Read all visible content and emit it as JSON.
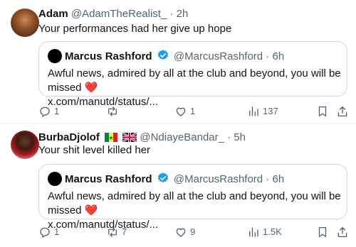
{
  "tweets": [
    {
      "name": "Adam",
      "handle": "@AdamTheRealist_",
      "separator": "·",
      "time": "2h",
      "text": "Your performances had her give up hope",
      "quote": {
        "name": "Marcus Rashford",
        "handle": "@MarcusRashford",
        "separator": "·",
        "time": "6h",
        "text": "Awful news, admired by all at the club and beyond, you will be missed",
        "link": "x.com/manutd/status/..."
      },
      "actions": {
        "replies": "1",
        "reposts": "",
        "likes": "1",
        "views": "137"
      }
    },
    {
      "name": "BurbaDjolof",
      "handle": "@NdiayeBandar_",
      "separator": "·",
      "time": "5h",
      "flags": [
        "senegal-flag",
        "uk-flag"
      ],
      "text": "Your shit level killed her",
      "quote": {
        "name": "Marcus Rashford",
        "handle": "@MarcusRashford",
        "separator": "·",
        "time": "6h",
        "text": "Awful news, admired by all at the club and beyond, you will be missed",
        "link": "x.com/manutd/status/..."
      },
      "actions": {
        "replies": "1",
        "reposts": "7",
        "likes": "9",
        "views": "1.5K"
      }
    }
  ],
  "colors": {
    "text": "#0f1419",
    "muted": "#536471",
    "border": "#cfd9de",
    "verified": "#1d9bf0",
    "heart": "#e0245e"
  },
  "icons": [
    "reply-icon",
    "repost-icon",
    "like-icon",
    "views-icon",
    "bookmark-icon",
    "share-icon",
    "verified-badge-icon"
  ]
}
